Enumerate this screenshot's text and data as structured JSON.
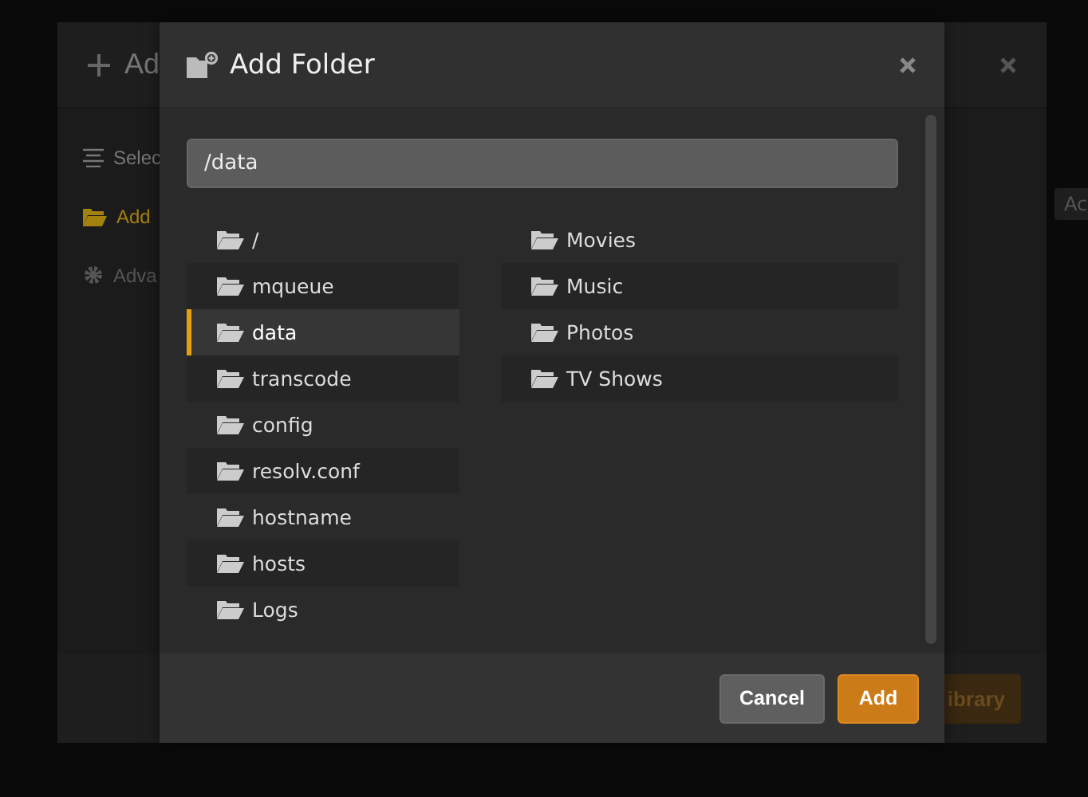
{
  "back_dialog": {
    "title": "Ad",
    "sidebar": {
      "items": [
        {
          "label": "Selec",
          "kind": "list",
          "selected": false,
          "disabled": false
        },
        {
          "label": "Add",
          "kind": "folder",
          "selected": true,
          "disabled": false
        },
        {
          "label": "Adva",
          "kind": "gear",
          "selected": false,
          "disabled": true
        }
      ]
    },
    "side_button": "Ac",
    "footer_button": "ibrary"
  },
  "dialog": {
    "title": "Add Folder",
    "path": "/data",
    "folders": [
      [
        {
          "name": "/",
          "selected": false
        },
        {
          "name": "mqueue",
          "selected": false
        },
        {
          "name": "data",
          "selected": true
        },
        {
          "name": "transcode",
          "selected": false
        },
        {
          "name": "config",
          "selected": false
        },
        {
          "name": "resolv.conf",
          "selected": false
        },
        {
          "name": "hostname",
          "selected": false
        },
        {
          "name": "hosts",
          "selected": false
        },
        {
          "name": "Logs",
          "selected": false
        }
      ],
      [
        {
          "name": "Movies",
          "selected": false
        },
        {
          "name": "Music",
          "selected": false
        },
        {
          "name": "Photos",
          "selected": false
        },
        {
          "name": "TV Shows",
          "selected": false
        }
      ]
    ],
    "buttons": [
      {
        "label": "Cancel",
        "kind": "secondary"
      },
      {
        "label": "Add",
        "kind": "primary"
      }
    ]
  }
}
